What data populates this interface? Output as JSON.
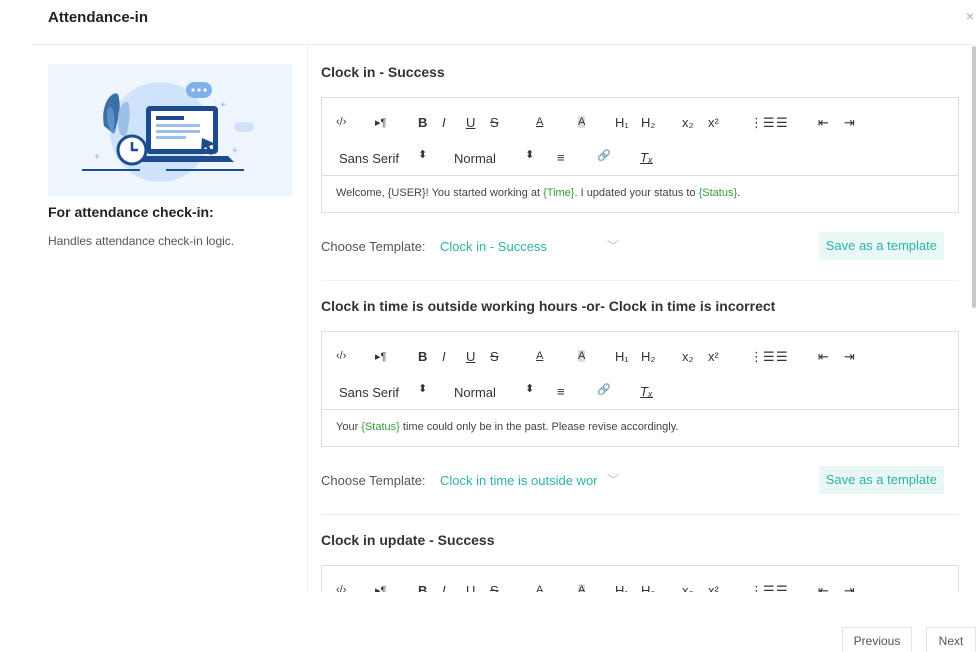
{
  "dialog": {
    "title": "Attendance-in",
    "close": "×"
  },
  "left": {
    "heading": "For attendance check-in:",
    "description": "Handles attendance check-in logic."
  },
  "toolbar": {
    "code": "‹/›",
    "para": "▸¶",
    "bold": "B",
    "italic": "I",
    "underline": "U",
    "strike": "S",
    "font_color": "A",
    "bg_color": "A",
    "h1": "H₁",
    "h2": "H₂",
    "sub": "x₂",
    "sup": "x²",
    "ordered": "⋮☰",
    "bullet": "☰",
    "outdent": "⇤",
    "indent": "⇥",
    "font": "Sans Serif",
    "size": "Normal",
    "stepper": "⬍",
    "align": "≡",
    "link": "🔗",
    "clear": "Tₓ"
  },
  "sections": [
    {
      "title": "Clock in - Success",
      "content": [
        {
          "t": "Welcome, {USER}! You started working at ",
          "v": false
        },
        {
          "t": "{Time}",
          "v": true
        },
        {
          "t": ". I updated your status to ",
          "v": false
        },
        {
          "t": "{Status}",
          "v": true
        },
        {
          "t": ".",
          "v": false
        }
      ],
      "template_label": "Choose Template:",
      "template_value": "Clock in - Success",
      "save_label": "Save as a template"
    },
    {
      "title": "Clock in time is outside working hours -or- Clock in time is incorrect",
      "content": [
        {
          "t": "Your ",
          "v": false
        },
        {
          "t": "{Status}",
          "v": true
        },
        {
          "t": " time could only be in the past. Please revise accordingly.",
          "v": false
        }
      ],
      "template_label": "Choose Template:",
      "template_value": "Clock in time is outside wor",
      "save_label": "Save as a template"
    },
    {
      "title": "Clock in update - Success"
    }
  ],
  "footer": {
    "previous": "Previous",
    "next": "Next"
  },
  "colors": {
    "accent": "#2bb3a3",
    "variable": "#3a9a3a",
    "illustration_bg": "#eef5fc"
  }
}
